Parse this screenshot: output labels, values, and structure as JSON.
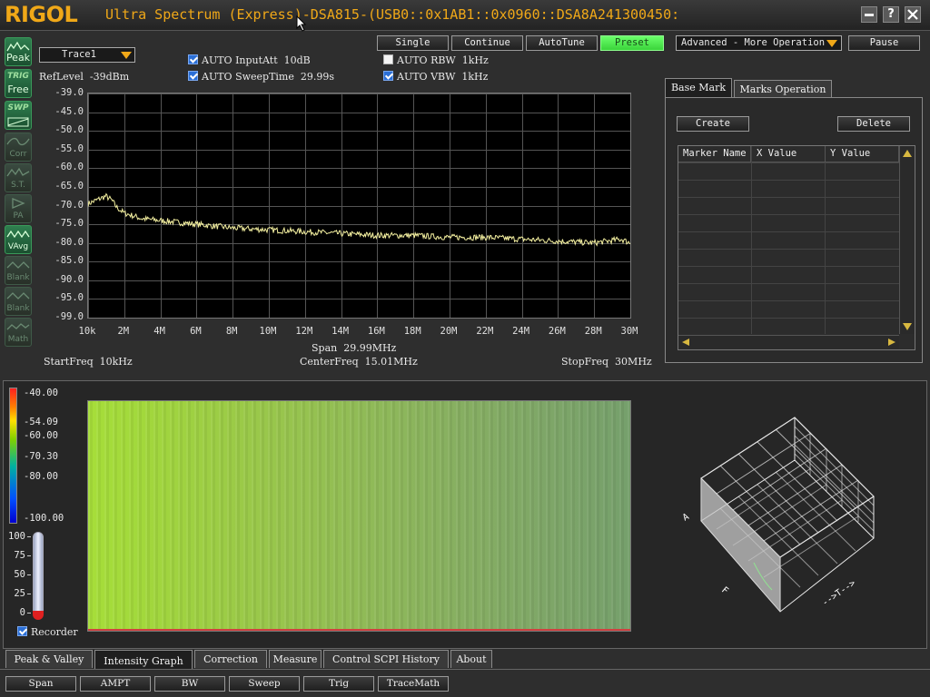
{
  "title_bar": {
    "logo": "RIGOL",
    "title": "Ultra Spectrum (Express)-DSA815-(USB0::0x1AB1::0x0960::DSA8A241300450:",
    "min_icon": "minimize-icon",
    "help_label": "?",
    "close_icon": "close-icon"
  },
  "sidebar": {
    "items": [
      {
        "label": "Peak",
        "state": "on"
      },
      {
        "label": "TRIG",
        "sub": "Free",
        "state": "on"
      },
      {
        "label": "SWP",
        "state": "on"
      },
      {
        "label": "Corr",
        "state": "off"
      },
      {
        "label": "S.T.",
        "state": "off"
      },
      {
        "label": "PA",
        "state": "off"
      },
      {
        "label": "VAvg",
        "state": "on"
      },
      {
        "label": "Blank",
        "state": "off"
      },
      {
        "label": "Blank",
        "state": "off"
      },
      {
        "label": "Math",
        "state": "off"
      }
    ]
  },
  "controls": {
    "trace_select": "Trace1",
    "ref_level": "RefLevel  -39dBm",
    "auto_input_att": "AUTO InputAtt  10dB",
    "auto_sweep_time": "AUTO SweepTime  29.99s",
    "auto_rbw": "AUTO RBW  1kHz",
    "auto_vbw": "AUTO VBW  1kHz",
    "single": "Single",
    "continue": "Continue",
    "autotune": "AutoTune",
    "preset": "Preset",
    "advanced": "Advanced - More Operation",
    "pause": "Pause"
  },
  "spectrum": {
    "span": "Span  29.99MHz",
    "start_freq": "StartFreq  10kHz",
    "center_freq": "CenterFreq  15.01MHz",
    "stop_freq": "StopFreq  30MHz",
    "trace_color": "#f4f0a0"
  },
  "chart_data": {
    "type": "line",
    "y_ticks": [
      "-39.0",
      "-45.0",
      "-50.0",
      "-55.0",
      "-60.0",
      "-65.0",
      "-70.0",
      "-75.0",
      "-80.0",
      "-85.0",
      "-90.0",
      "-95.0",
      "-99.0"
    ],
    "x_ticks": [
      "10k",
      "2M",
      "4M",
      "6M",
      "8M",
      "10M",
      "12M",
      "14M",
      "16M",
      "18M",
      "20M",
      "22M",
      "24M",
      "26M",
      "28M",
      "30M"
    ],
    "ylim": [
      -99,
      -39
    ],
    "xlim": [
      0.01,
      30
    ],
    "series": [
      {
        "x": [
          0.01,
          0.5,
          1.0,
          1.3,
          1.6,
          2.0,
          3.0,
          4.0,
          6.0,
          8.0,
          10.0,
          12.0,
          14.0,
          16.0,
          18.0,
          20.0,
          22.0,
          24.0,
          26.0,
          28.0,
          29.5,
          30.0
        ],
        "values": [
          -68.5,
          -67.5,
          -66.5,
          -67.5,
          -69.5,
          -71.0,
          -72.5,
          -73.0,
          -74.0,
          -75.0,
          -75.5,
          -76.0,
          -76.5,
          -77.0,
          -77.0,
          -77.5,
          -77.5,
          -78.0,
          -78.5,
          -79.0,
          -78.0,
          -79.0
        ]
      }
    ],
    "grid": true
  },
  "marker_panel": {
    "tab_base": "Base Mark",
    "tab_ops": "Marks Operation",
    "create": "Create",
    "delete": "Delete",
    "col_name": "Marker Name",
    "col_x": "X Value",
    "col_y": "Y Value"
  },
  "intensity": {
    "scale": [
      "-40.00",
      "-54.09",
      "-60.00",
      "-70.30",
      "-80.00",
      "-100.00"
    ],
    "persistence": [
      "100",
      "75",
      "50",
      "25",
      "0"
    ],
    "recorder": "Recorder",
    "axis_f": "F",
    "axis_t": "-->T-->",
    "axis_a": "A"
  },
  "bottom_tabs": [
    "Peak & Valley",
    "Intensity Graph",
    "Correction",
    "Measure",
    "Control SCPI History",
    "About"
  ],
  "bottom_buttons": [
    "Span",
    "AMPT",
    "BW",
    "Sweep",
    "Trig",
    "TraceMath"
  ]
}
